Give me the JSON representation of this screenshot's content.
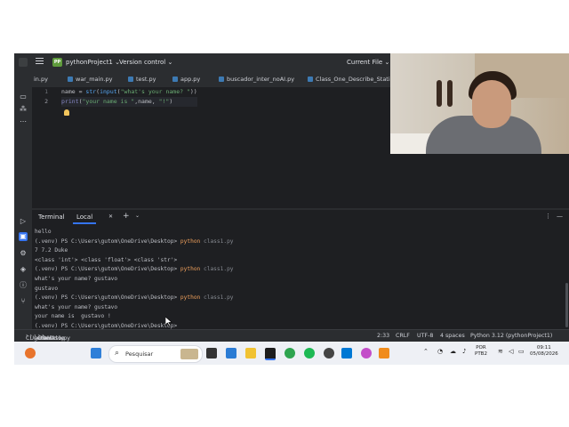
{
  "titlebar": {
    "project_badge": "PP",
    "project_name": "pythonProject1",
    "vcs": "Version control",
    "run_config": "Current File"
  },
  "tabs": [
    {
      "label": "in.py"
    },
    {
      "label": "war_main.py"
    },
    {
      "label": "test.py"
    },
    {
      "label": "app.py"
    },
    {
      "label": "buscador_inter_noAI.py"
    },
    {
      "label": "Class_One_Describe_Statisti"
    }
  ],
  "editor": {
    "line_numbers": [
      "1",
      "2"
    ],
    "line1": {
      "a": "name = ",
      "fn1": "str",
      "b": "(",
      "fn2": "input",
      "c": "(",
      "s": "\"what's your name? \"",
      "d": "))"
    },
    "line2": {
      "fn": "print",
      "a": "(",
      "s1": "\"your name is \"",
      "b": ",name, ",
      "s2": "\"!\"",
      "c": ")"
    }
  },
  "terminal": {
    "title": "Terminal",
    "tab_label": "Local",
    "lines": [
      {
        "text": "hello"
      },
      {
        "prompt": "(.venv) PS C:\\Users\\gutom\\OneDrive\\Desktop> ",
        "cmd": "python",
        "arg": " class1.py"
      },
      {
        "text": "7 7.2 Duke"
      },
      {
        "text": "<class 'int'> <class 'float'> <class 'str'>"
      },
      {
        "prompt": "(.venv) PS C:\\Users\\gutom\\OneDrive\\Desktop> ",
        "cmd": "python",
        "arg": " class1.py"
      },
      {
        "text": "what's your name? gustavo"
      },
      {
        "text": "gustavo"
      },
      {
        "prompt": "(.venv) PS C:\\Users\\gutom\\OneDrive\\Desktop> ",
        "cmd": "python",
        "arg": " class1.py"
      },
      {
        "text": "what's your name? gustavo"
      },
      {
        "text": "your name is  gustavo !"
      },
      {
        "prompt": "(.venv) PS C:\\Users\\gutom\\OneDrive\\Desktop> ",
        "cmd": "",
        "arg": ""
      }
    ]
  },
  "statusbar": {
    "breadcrumb": [
      "C:",
      "Users",
      "gutom",
      "OneDrive",
      "Desktop",
      "class1.py"
    ],
    "position": "2:33",
    "line_sep": "CRLF",
    "encoding": "UTF-8",
    "indent": "4 spaces",
    "interpreter": "Python 3.12 (pythonProject1)"
  },
  "taskbar": {
    "search_placeholder": "Pesquisar",
    "lang_1": "POR",
    "lang_2": "PTB2",
    "time": "09:11",
    "date": "05/08/2026"
  },
  "colors": {
    "ide_bg": "#1e1f22",
    "ide_panel": "#2b2d30",
    "accent": "#3574f0",
    "string": "#6aab73",
    "function": "#56a8f5"
  }
}
